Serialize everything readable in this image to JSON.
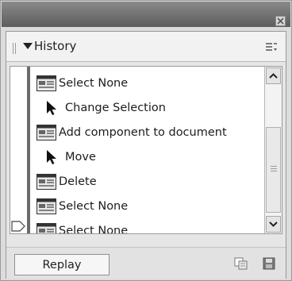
{
  "panel": {
    "title": "History",
    "replay_label": "Replay"
  },
  "history": {
    "items": [
      {
        "label": "Select None",
        "icon": "doc-step-icon"
      },
      {
        "label": "Change Selection",
        "icon": "arrow-pointer-icon"
      },
      {
        "label": "Add component to document",
        "icon": "doc-step-icon"
      },
      {
        "label": "Move",
        "icon": "arrow-pointer-icon"
      },
      {
        "label": "Delete",
        "icon": "doc-step-icon"
      },
      {
        "label": "Select None",
        "icon": "doc-step-icon"
      },
      {
        "label": "Select None",
        "icon": "doc-step-icon"
      }
    ]
  },
  "colors": {
    "titlebar": "#6d6d6d",
    "panel_bg": "#e6e6e6",
    "list_bg": "#ffffff",
    "slider": "#6b6b6b"
  }
}
